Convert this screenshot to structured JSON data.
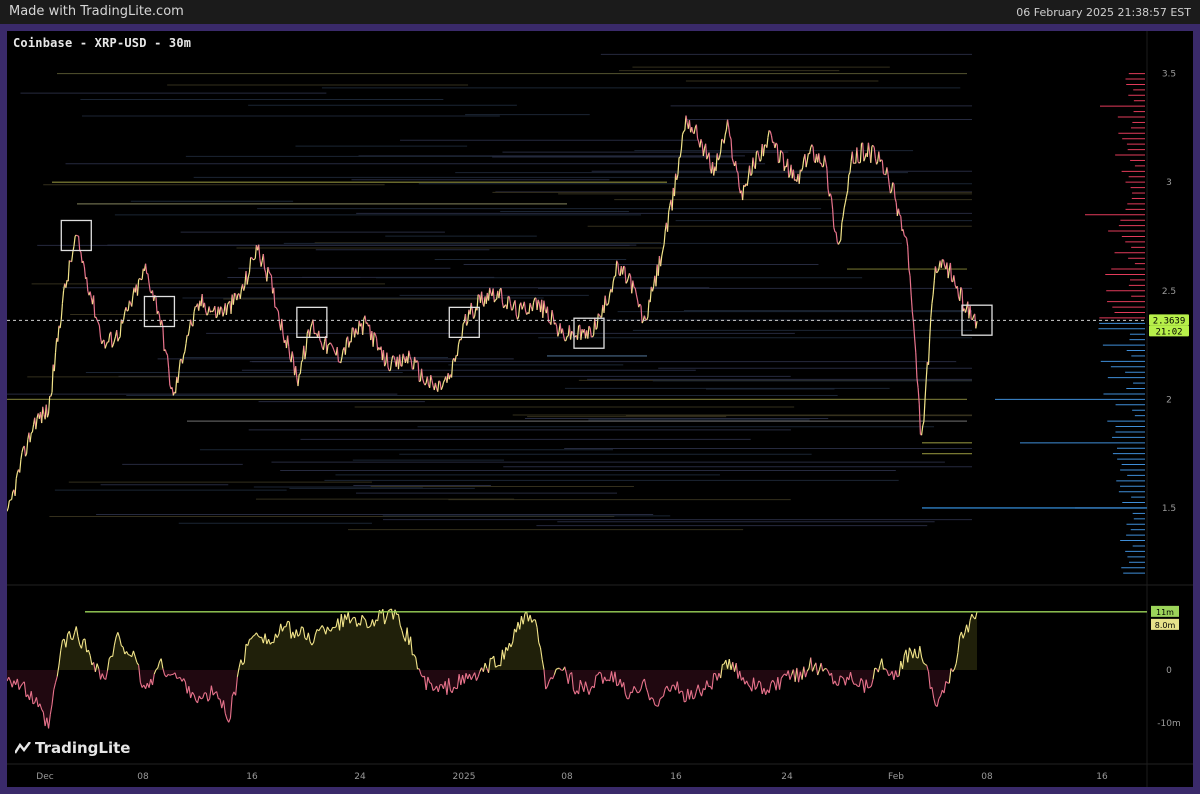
{
  "header": {
    "app_credit": "Made with TradingLite.com",
    "timestamp": "06 February 2025 21:38:57 EST"
  },
  "chart_title": "Coinbase - XRP-USD - 30m",
  "logo_text": "TradingLite",
  "colors": {
    "background": "#000000",
    "frame": "#3a2a6a",
    "price_up": "#f3e58a",
    "price_down": "#e8738c",
    "bid_profile": "#3f8ed8",
    "ask_profile": "#e23b5a",
    "highlight_line": "#9cd45a",
    "box": "#e0e0e0"
  },
  "chart_data": [
    {
      "type": "line",
      "title": "Coinbase - XRP-USD - 30m",
      "x_ticks": [
        "Dec",
        "08",
        "16",
        "24",
        "2025",
        "08",
        "16",
        "24",
        "Feb",
        "08",
        "16"
      ],
      "y_ticks": [
        "3.5",
        "3",
        "2.5",
        "2",
        "1.5"
      ],
      "ylim": [
        1.15,
        3.65
      ],
      "current_price": "2.3639",
      "countdown": "21:02",
      "price_series": {
        "x": [
          "Nov 28",
          "Nov 29",
          "Nov 30",
          "Dec 1",
          "Dec 2",
          "Dec 3",
          "Dec 4",
          "Dec 5",
          "Dec 6",
          "Dec 7",
          "Dec 8",
          "Dec 9",
          "Dec 10",
          "Dec 11",
          "Dec 12",
          "Dec 13",
          "Dec 14",
          "Dec 15",
          "Dec 16",
          "Dec 17",
          "Dec 18",
          "Dec 19",
          "Dec 20",
          "Dec 21",
          "Dec 22",
          "Dec 23",
          "Dec 24",
          "Dec 25",
          "Dec 26",
          "Dec 27",
          "Dec 28",
          "Dec 29",
          "Dec 30",
          "Dec 31",
          "Jan 1",
          "Jan 2",
          "Jan 3",
          "Jan 4",
          "Jan 5",
          "Jan 6",
          "Jan 7",
          "Jan 8",
          "Jan 9",
          "Jan 10",
          "Jan 11",
          "Jan 12",
          "Jan 13",
          "Jan 14",
          "Jan 15",
          "Jan 16",
          "Jan 17",
          "Jan 18",
          "Jan 19",
          "Jan 20",
          "Jan 21",
          "Jan 22",
          "Jan 23",
          "Jan 24",
          "Jan 25",
          "Jan 26",
          "Jan 27",
          "Jan 28",
          "Jan 29",
          "Jan 30",
          "Jan 31",
          "Feb 1",
          "Feb 2",
          "Feb 3",
          "Feb 4",
          "Feb 5",
          "Feb 6"
        ],
        "values": [
          1.45,
          1.7,
          1.9,
          1.95,
          2.45,
          2.75,
          2.5,
          2.25,
          2.3,
          2.45,
          2.6,
          2.4,
          2.0,
          2.3,
          2.45,
          2.4,
          2.42,
          2.5,
          2.7,
          2.55,
          2.3,
          2.1,
          2.35,
          2.25,
          2.2,
          2.3,
          2.35,
          2.2,
          2.15,
          2.2,
          2.1,
          2.05,
          2.1,
          2.35,
          2.45,
          2.5,
          2.45,
          2.4,
          2.45,
          2.4,
          2.3,
          2.3,
          2.3,
          2.4,
          2.6,
          2.55,
          2.35,
          2.6,
          2.9,
          3.3,
          3.2,
          3.05,
          3.25,
          2.95,
          3.1,
          3.2,
          3.1,
          3.0,
          3.15,
          3.1,
          2.7,
          3.1,
          3.15,
          3.1,
          2.95,
          2.7,
          1.8,
          2.6,
          2.6,
          2.45,
          2.36
        ]
      },
      "annotation_boxes": [
        "Dec 3",
        "Dec 9",
        "Dec 20",
        "Dec 31",
        "Jan 9",
        "Feb 6"
      ]
    },
    {
      "type": "area",
      "title": "",
      "y_ticks": [
        "0",
        "-10m"
      ],
      "ylim": [
        -14,
        14
      ],
      "labels": [
        "11m",
        "8.0m"
      ],
      "values": [
        -1,
        -3,
        -6,
        -11,
        5,
        7,
        3,
        -2,
        6,
        3,
        -4,
        1,
        -1,
        -3,
        -6,
        -4,
        -9,
        2,
        8,
        5,
        8,
        7,
        6,
        8,
        9,
        10,
        9,
        10,
        10,
        6,
        -2,
        -4,
        -3,
        -2,
        -1,
        1,
        3,
        9,
        10,
        -4,
        1,
        -3,
        -4,
        -1,
        -2,
        -5,
        -3,
        -6,
        -3,
        -5,
        -4,
        -2,
        1,
        -1,
        -3,
        -4,
        -2,
        -1,
        1,
        0,
        -2,
        -1,
        -3,
        1,
        -2,
        3,
        4,
        -6,
        -2,
        7,
        11
      ]
    }
  ]
}
